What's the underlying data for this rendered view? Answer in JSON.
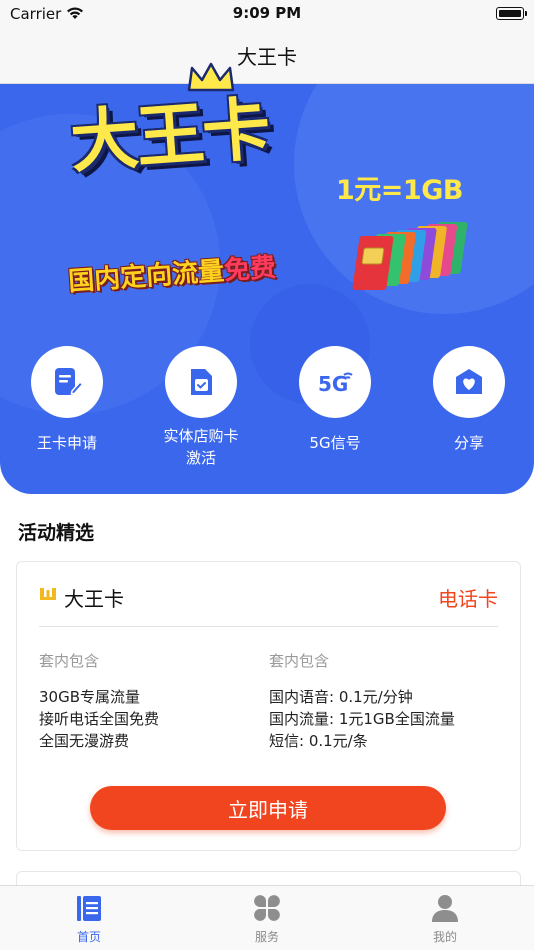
{
  "status_bar": {
    "carrier": "Carrier",
    "time": "9:09 PM"
  },
  "nav": {
    "title": "大王卡"
  },
  "banner": {
    "brand_text": "大王卡",
    "price_text": "1元=1GB",
    "slogan_main": "国内定向流量",
    "slogan_highlight": "免费"
  },
  "quick_actions": [
    {
      "label": "王卡申请",
      "icon": "edit-document-icon"
    },
    {
      "label": "实体店购卡\n激活",
      "label_line1": "实体店购卡",
      "label_line2": "激活",
      "icon": "sim-card-icon"
    },
    {
      "label": "5G信号",
      "icon": "5g-signal-icon"
    },
    {
      "label": "分享",
      "icon": "share-heart-icon"
    }
  ],
  "section": {
    "title": "活动精选"
  },
  "product_card": {
    "name": "大王卡",
    "type_badge": "电话卡",
    "left_column": {
      "heading": "套内包含",
      "items": [
        "30GB专属流量",
        "接听电话全国免费",
        "全国无漫游费"
      ]
    },
    "right_column": {
      "heading": "套内包含",
      "items": [
        "国内语音: 0.1元/分钟",
        "国内流量: 1元1GB全国流量",
        "短信: 0.1元/条"
      ]
    },
    "apply_label": "立即申请"
  },
  "tab_bar": {
    "tabs": [
      {
        "label": "首页",
        "icon": "home-list-icon",
        "active": true
      },
      {
        "label": "服务",
        "icon": "grid-services-icon",
        "active": false
      },
      {
        "label": "我的",
        "icon": "user-profile-icon",
        "active": false
      }
    ]
  },
  "colors": {
    "primary_blue": "#3b67ec",
    "accent_red": "#f0451e",
    "brand_yellow": "#ffe94a"
  }
}
